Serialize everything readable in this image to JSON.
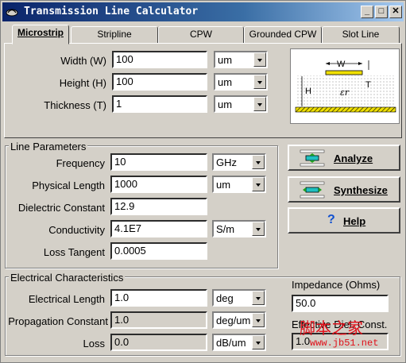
{
  "window": {
    "title": "Transmission Line Calculator",
    "min_label": "_",
    "max_label": "□",
    "close_label": "✕"
  },
  "tabs": [
    {
      "label": "Microstrip"
    },
    {
      "label": "Stripline"
    },
    {
      "label": "CPW"
    },
    {
      "label": "Grounded CPW"
    },
    {
      "label": "Slot Line"
    }
  ],
  "geometry": {
    "width": {
      "label": "Width (W)",
      "value": "100",
      "unit": "um"
    },
    "height": {
      "label": "Height (H)",
      "value": "100",
      "unit": "um"
    },
    "thickness": {
      "label": "Thickness (T)",
      "value": "1",
      "unit": "um"
    }
  },
  "diagram": {
    "w_label": "W",
    "t_label": "T",
    "h_label": "H",
    "er_label": "εr"
  },
  "line_params": {
    "title": "Line Parameters",
    "frequency": {
      "label": "Frequency",
      "value": "10",
      "unit": "GHz"
    },
    "physical_length": {
      "label": "Physical Length",
      "value": "1000",
      "unit": "um"
    },
    "dielectric_constant": {
      "label": "Dielectric Constant",
      "value": "12.9"
    },
    "conductivity": {
      "label": "Conductivity",
      "value": "4.1E7",
      "unit": "S/m"
    },
    "loss_tangent": {
      "label": "Loss Tangent",
      "value": "0.0005"
    }
  },
  "actions": {
    "analyze": "Analyze",
    "synthesize": "Synthesize",
    "help": "Help"
  },
  "electrical": {
    "title": "Electrical Characteristics",
    "electrical_length": {
      "label": "Electrical Length",
      "value": "1.0",
      "unit": "deg"
    },
    "propagation_constant": {
      "label": "Propagation Constant",
      "value": "1.0",
      "unit": "deg/um"
    },
    "loss": {
      "label": "Loss",
      "value": "0.0",
      "unit": "dB/um"
    },
    "impedance": {
      "label": "Impedance (Ohms)",
      "value": "50.0"
    },
    "eff_diel": {
      "label": "Effective Diel. Const.",
      "value": "1.0"
    }
  },
  "watermark": {
    "text": "脚本之家",
    "url": "www.jb51.net"
  }
}
